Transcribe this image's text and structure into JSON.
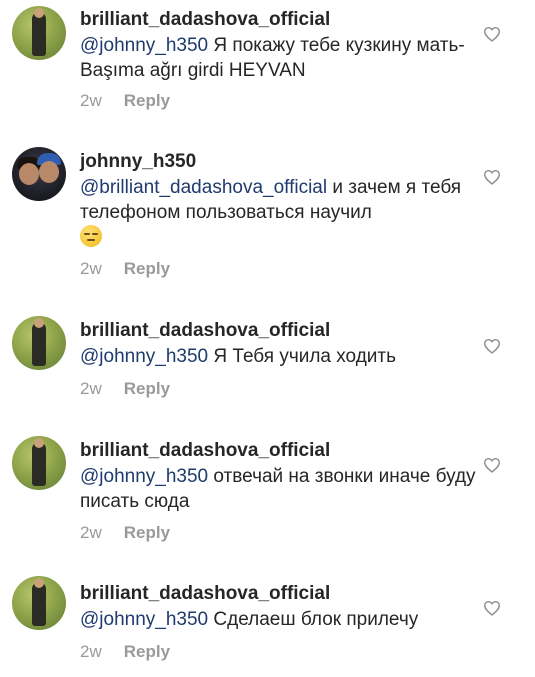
{
  "comments": [
    {
      "username": "brilliant_dadashova_official",
      "mention": "@johnny_h350",
      "text": " Я покажу тебе кузкину мать- Başıma ağrı girdi HEYVAN",
      "time": "2w",
      "reply": "Reply",
      "avatar_icon": "lady-in-field-avatar"
    },
    {
      "username": "johnny_h350",
      "mention": "@brilliant_dadashova_official",
      "text": " и зачем я тебя телефоном пользоваться научил",
      "emoji": "unamused-face-emoji",
      "time": "2w",
      "reply": "Reply",
      "avatar_icon": "two-men-avatar"
    },
    {
      "username": "brilliant_dadashova_official",
      "mention": "@johnny_h350",
      "text": " Я Тебя учила ходить",
      "time": "2w",
      "reply": "Reply",
      "avatar_icon": "lady-in-field-avatar"
    },
    {
      "username": "brilliant_dadashova_official",
      "mention": "@johnny_h350",
      "text": " отвечай на звонки иначе буду писать сюда",
      "time": "2w",
      "reply": "Reply",
      "avatar_icon": "lady-in-field-avatar"
    },
    {
      "username": "brilliant_dadashova_official",
      "mention": "@johnny_h350",
      "text": " Сделаеш блок прилечу",
      "time": "2w",
      "reply": "Reply",
      "avatar_icon": "lady-in-field-avatar"
    }
  ],
  "colors": {
    "text": "#262626",
    "mention": "#1f3b6e",
    "meta": "#9a9a9a",
    "heart_outline": "#8e8e8e"
  }
}
